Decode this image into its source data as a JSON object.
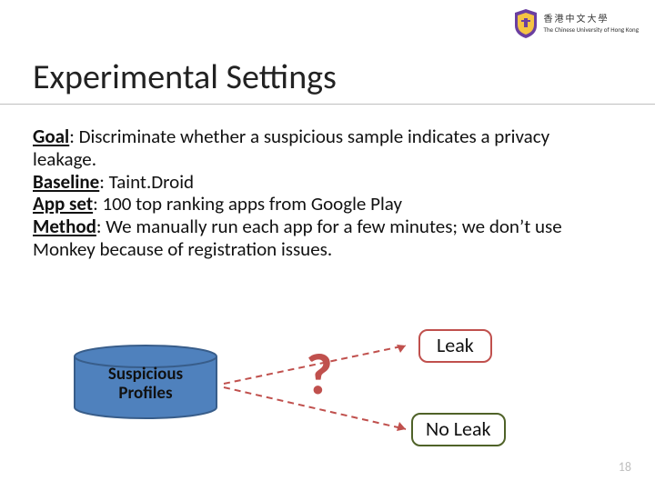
{
  "logo": {
    "cn": "香港中文大學",
    "en": "The Chinese University of Hong Kong"
  },
  "title": "Experimental Settings",
  "body": {
    "goal_label": "Goal",
    "goal_text": ": Discriminate whether a suspicious sample indicates a privacy leakage.",
    "baseline_label": "Baseline",
    "baseline_text": ": Taint.Droid",
    "appset_label": "App set",
    "appset_text": ": 100 top ranking apps from Google Play",
    "method_label": "Method",
    "method_text": ": We manually run each app for a few minutes; we don’t use Monkey because of registration issues."
  },
  "diagram": {
    "cylinder_label_l1": "Suspicious",
    "cylinder_label_l2": "Profiles",
    "question": "?",
    "leak": "Leak",
    "noleak": "No Leak"
  },
  "page_number": "18",
  "colors": {
    "accent_red": "#c0504d",
    "accent_green": "#4f6228",
    "cylinder_fill": "#4f81bd",
    "cylinder_stroke": "#385d8a"
  }
}
